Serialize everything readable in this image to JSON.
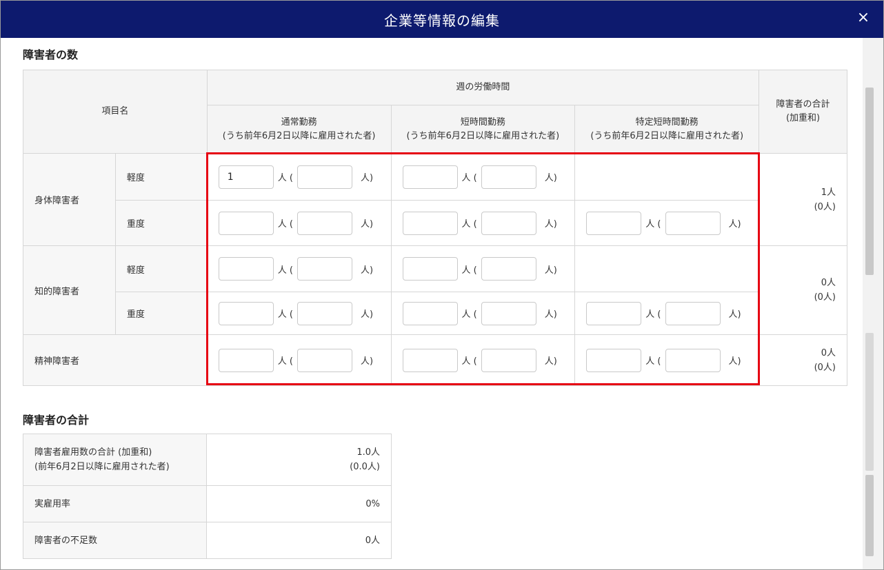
{
  "modal": {
    "title": "企業等情報の編集",
    "close_symbol": "×"
  },
  "section1": {
    "title": "障害者の数"
  },
  "main_table": {
    "header_item": "項目名",
    "header_hours": "週の労働時間",
    "header_total": [
      "障害者の合計",
      "(加重和)"
    ],
    "col_normal": [
      "通常勤務",
      "(うち前年6月2日以降に雇用された者)"
    ],
    "col_short": [
      "短時間勤務",
      "(うち前年6月2日以降に雇用された者)"
    ],
    "col_special": [
      "特定短時間勤務",
      "(うち前年6月2日以降に雇用された者)"
    ],
    "unit_open": "人 (",
    "unit_close": "人)",
    "categories": {
      "physical": "身体障害者",
      "intellectual": "知的障害者",
      "mental": "精神障害者"
    },
    "levels": {
      "mild": "軽度",
      "severe": "重度"
    },
    "physical_mild_normal_value": "1",
    "totals": {
      "physical": [
        "1人",
        "(0人)"
      ],
      "intellectual": [
        "0人",
        "(0人)"
      ],
      "mental": [
        "0人",
        "(0人)"
      ]
    }
  },
  "section2": {
    "title": "障害者の合計"
  },
  "sum_table": {
    "row1_label": [
      "障害者雇用数の合計 (加重和)",
      "(前年6月2日以降に雇用された者)"
    ],
    "row1_value": [
      "1.0人",
      "(0.0人)"
    ],
    "row2_label": "実雇用率",
    "row2_value": "0%",
    "row3_label": "障害者の不足数",
    "row3_value": "0人"
  }
}
